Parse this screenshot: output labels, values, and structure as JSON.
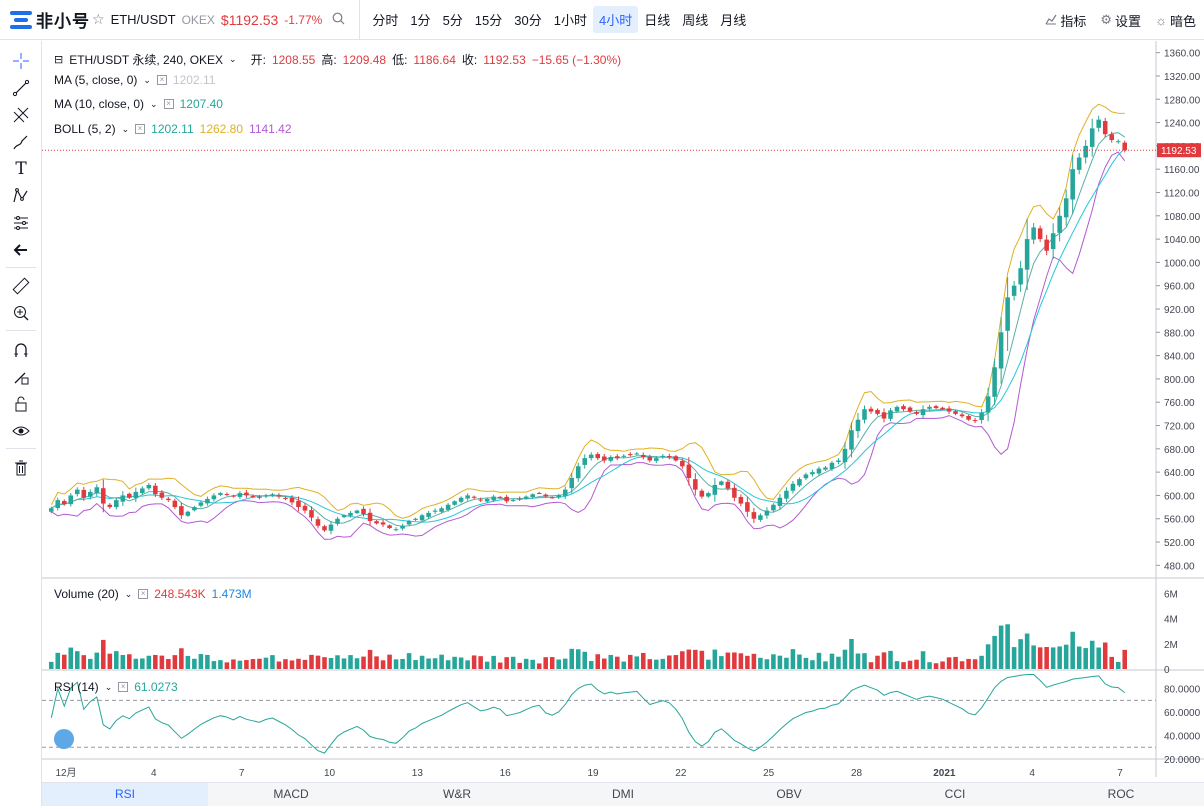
{
  "topbar": {
    "logo_text": "非小号",
    "symbol": "ETH/USDT",
    "exchange": "OKEX",
    "price": "$1192.53",
    "change": "-1.77%",
    "intervals": [
      "分时",
      "1分",
      "5分",
      "15分",
      "30分",
      "1小时",
      "4小时",
      "日线",
      "周线",
      "月线"
    ],
    "active_interval": "4小时",
    "indicators_label": "指标",
    "settings_label": "设置",
    "theme_label": "暗色"
  },
  "legend": {
    "main": {
      "title": "ETH/USDT 永续, 240, OKEX",
      "open_label": "开:",
      "open": "1208.55",
      "high_label": "高:",
      "high": "1209.48",
      "low_label": "低:",
      "low": "1186.64",
      "close_label": "收:",
      "close": "1192.53",
      "change": "−15.65 (−1.30%)"
    },
    "ma5": {
      "label": "MA (5, close, 0)",
      "value": "1202.11"
    },
    "ma10": {
      "label": "MA (10, close, 0)",
      "value": "1207.40"
    },
    "boll": {
      "label": "BOLL (5, 2)",
      "mid": "1202.11",
      "upper": "1262.80",
      "lower": "1141.42"
    },
    "volume": {
      "label": "Volume (20)",
      "value": "248.543K",
      "ma": "1.473M"
    },
    "rsi": {
      "label": "RSI (14)",
      "value": "61.0273"
    }
  },
  "price_axis": {
    "ticks": [
      "1360.00",
      "1320.00",
      "1280.00",
      "1240.00",
      "1200.00",
      "1160.00",
      "1120.00",
      "1080.00",
      "1040.00",
      "1000.00",
      "960.00",
      "920.00",
      "880.00",
      "840.00",
      "800.00",
      "760.00",
      "720.00",
      "680.00",
      "640.00",
      "600.00",
      "560.00",
      "520.00",
      "480.00"
    ],
    "last_price": "1192.53"
  },
  "volume_axis": {
    "ticks": [
      "6M",
      "4M",
      "2M",
      "0"
    ]
  },
  "rsi_axis": {
    "ticks": [
      "80.0000",
      "60.0000",
      "40.0000",
      "20.0000"
    ]
  },
  "time_axis": {
    "labels": [
      "12月",
      "4",
      "7",
      "10",
      "13",
      "16",
      "19",
      "22",
      "25",
      "28",
      "2021",
      "4",
      "7"
    ]
  },
  "bottom_tabs": [
    "RSI",
    "MACD",
    "W&R",
    "DMI",
    "OBV",
    "CCI",
    "ROC"
  ],
  "active_tab": "RSI",
  "colors": {
    "up": "#26a69a",
    "down": "#e03a3e",
    "accent": "#2962ff",
    "ma5": "#c0c4cc",
    "ma10": "#26c6da",
    "boll_upper": "#e0b022",
    "boll_lower": "#b35ad1"
  },
  "chart_data": {
    "type": "candlestick",
    "ylim": [
      460,
      1380
    ],
    "closes": [
      578,
      592,
      585,
      600,
      610,
      596,
      606,
      614,
      586,
      580,
      592,
      600,
      596,
      606,
      612,
      618,
      602,
      596,
      592,
      580,
      566,
      572,
      580,
      588,
      594,
      600,
      604,
      602,
      598,
      604,
      600,
      598,
      596,
      600,
      602,
      598,
      594,
      588,
      580,
      574,
      562,
      548,
      540,
      550,
      560,
      566,
      570,
      574,
      568,
      556,
      552,
      550,
      544,
      542,
      548,
      556,
      560,
      566,
      570,
      574,
      578,
      584,
      590,
      596,
      600,
      596,
      592,
      594,
      598,
      596,
      590,
      592,
      594,
      598,
      602,
      604,
      598,
      596,
      600,
      610,
      630,
      650,
      664,
      670,
      664,
      660,
      666,
      664,
      668,
      670,
      672,
      666,
      660,
      664,
      668,
      666,
      660,
      650,
      630,
      610,
      598,
      604,
      618,
      624,
      612,
      596,
      586,
      572,
      560,
      566,
      574,
      584,
      596,
      608,
      620,
      628,
      636,
      640,
      646,
      648,
      656,
      660,
      680,
      712,
      730,
      748,
      744,
      740,
      732,
      746,
      752,
      748,
      744,
      740,
      748,
      752,
      750,
      748,
      744,
      740,
      736,
      730,
      728,
      742,
      770,
      820,
      880,
      940,
      960,
      990,
      1040,
      1060,
      1040,
      1020,
      1050,
      1080,
      1110,
      1160,
      1180,
      1200,
      1230,
      1245,
      1220,
      1210,
      1208,
      1192.53
    ],
    "volume_ylim": [
      0,
      6500000
    ],
    "rsi_ylim": [
      20,
      95
    ],
    "rsi_levels": [
      70,
      30
    ]
  }
}
